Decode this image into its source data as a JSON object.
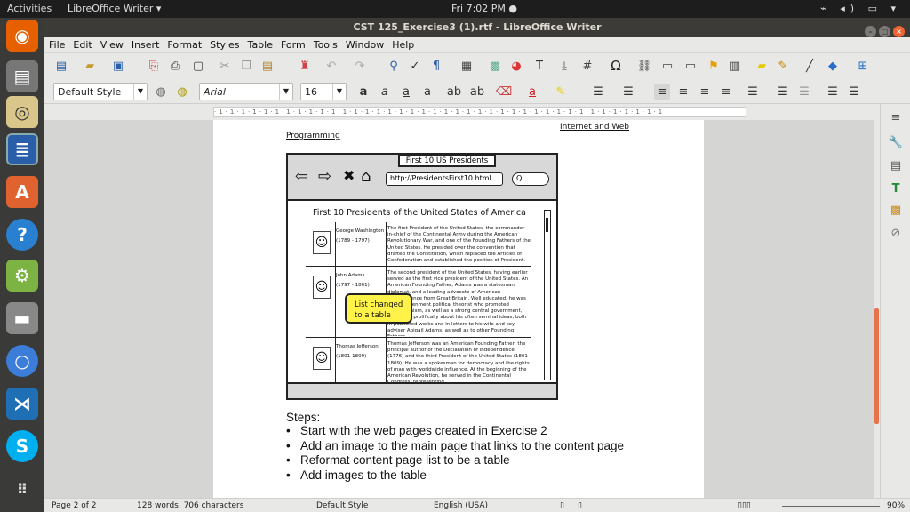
{
  "topbar": {
    "activities": "Activities",
    "app": "LibreOffice Writer ▾",
    "clock": "Fri  7:02 PM ●",
    "tray": "⌁ ◂) ▭ ▾"
  },
  "window": {
    "title": "CST 125_Exercise3 (1).rtf - LibreOffice Writer"
  },
  "menu": [
    "File",
    "Edit",
    "View",
    "Insert",
    "Format",
    "Styles",
    "Table",
    "Form",
    "Tools",
    "Window",
    "Help"
  ],
  "format": {
    "paragraph_style": "Default Style",
    "font_name": "Arial",
    "font_size": "16"
  },
  "document": {
    "header_left": "Programming",
    "header_right": "Internet and Web",
    "mockup": {
      "tab": "First 10 US Presidents",
      "url": "http://PresidentsFirst10.html",
      "search": "Q",
      "title": "First 10 Presidents of the United States of America",
      "callout": "List changed to a table",
      "rows": [
        {
          "name": "George Washington",
          "years": "(1789 - 1797)",
          "desc": "The first President of the United States, the commander-in-chief of the Continental Army during the American Revolutionary War, and one of the Founding Fathers of the United States. He presided over the convention that drafted the Constitution, which replaced the Articles of Confederation and established the position of President."
        },
        {
          "name": "John Adams",
          "years": "(1797 - 1801)",
          "desc": "The second president of the United States, having earlier served as the first vice president of the United States. An American Founding Father, Adams was a statesman, diplomat, and a leading advocate of American independence from Great Britain. Well educated, he was an Enlightenment political theorist who promoted republicanism, as well as a strong central government, and wrote prolifically about his often seminal ideas, both in published works and in letters to his wife and key adviser Abigail Adams, as well as to other Founding Fathers."
        },
        {
          "name": "Thomas Jefferson",
          "years": "(1801-1809)",
          "desc": "Thomas Jefferson was an American Founding Father, the principal author of the Declaration of Independence (1776) and the third President of the United States (1801–1809). He was a spokesman for democracy and the rights of man with worldwide influence. At the beginning of the American Revolution, he served in the Continental Congress, representing"
        }
      ]
    },
    "steps_label": "Steps:",
    "steps": [
      "Start with the web pages created in Exercise 2",
      "Add an image to the main page that links to the content page",
      "Reformat content page list to be a table",
      "Add images to the table"
    ]
  },
  "status": {
    "page": "Page 2 of 2",
    "words": "128 words, 706 characters",
    "style": "Default Style",
    "language": "English (USA)",
    "zoom": "90%"
  }
}
